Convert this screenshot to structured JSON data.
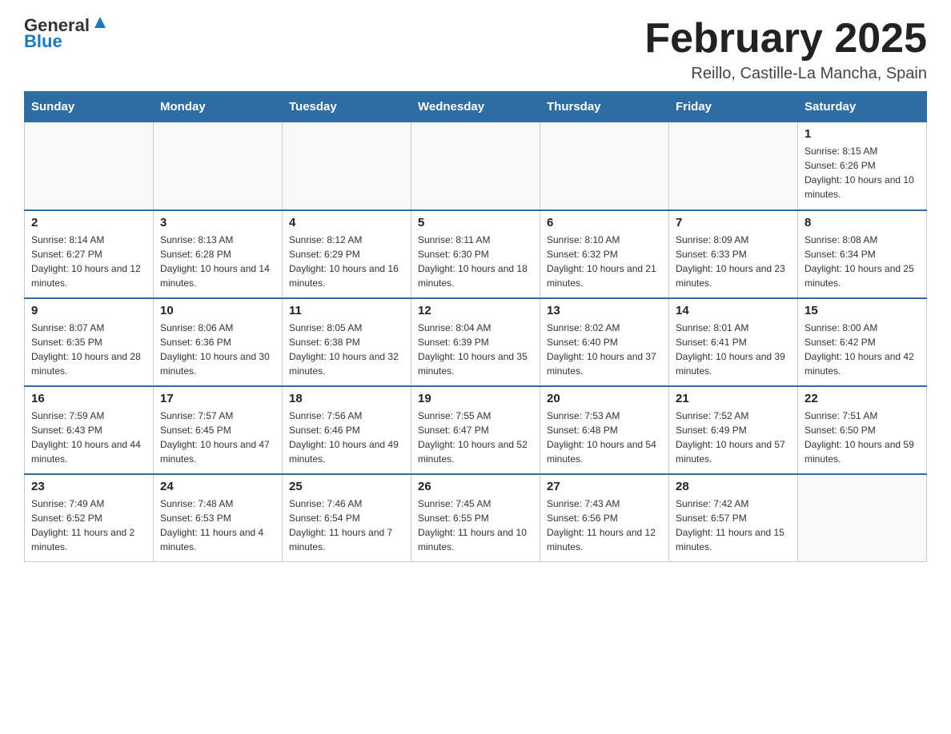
{
  "logo": {
    "general": "General",
    "blue": "Blue",
    "alt": "GeneralBlue logo"
  },
  "title": "February 2025",
  "location": "Reillo, Castille-La Mancha, Spain",
  "headers": [
    "Sunday",
    "Monday",
    "Tuesday",
    "Wednesday",
    "Thursday",
    "Friday",
    "Saturday"
  ],
  "weeks": [
    [
      {
        "day": "",
        "info": ""
      },
      {
        "day": "",
        "info": ""
      },
      {
        "day": "",
        "info": ""
      },
      {
        "day": "",
        "info": ""
      },
      {
        "day": "",
        "info": ""
      },
      {
        "day": "",
        "info": ""
      },
      {
        "day": "1",
        "info": "Sunrise: 8:15 AM\nSunset: 6:26 PM\nDaylight: 10 hours and 10 minutes."
      }
    ],
    [
      {
        "day": "2",
        "info": "Sunrise: 8:14 AM\nSunset: 6:27 PM\nDaylight: 10 hours and 12 minutes."
      },
      {
        "day": "3",
        "info": "Sunrise: 8:13 AM\nSunset: 6:28 PM\nDaylight: 10 hours and 14 minutes."
      },
      {
        "day": "4",
        "info": "Sunrise: 8:12 AM\nSunset: 6:29 PM\nDaylight: 10 hours and 16 minutes."
      },
      {
        "day": "5",
        "info": "Sunrise: 8:11 AM\nSunset: 6:30 PM\nDaylight: 10 hours and 18 minutes."
      },
      {
        "day": "6",
        "info": "Sunrise: 8:10 AM\nSunset: 6:32 PM\nDaylight: 10 hours and 21 minutes."
      },
      {
        "day": "7",
        "info": "Sunrise: 8:09 AM\nSunset: 6:33 PM\nDaylight: 10 hours and 23 minutes."
      },
      {
        "day": "8",
        "info": "Sunrise: 8:08 AM\nSunset: 6:34 PM\nDaylight: 10 hours and 25 minutes."
      }
    ],
    [
      {
        "day": "9",
        "info": "Sunrise: 8:07 AM\nSunset: 6:35 PM\nDaylight: 10 hours and 28 minutes."
      },
      {
        "day": "10",
        "info": "Sunrise: 8:06 AM\nSunset: 6:36 PM\nDaylight: 10 hours and 30 minutes."
      },
      {
        "day": "11",
        "info": "Sunrise: 8:05 AM\nSunset: 6:38 PM\nDaylight: 10 hours and 32 minutes."
      },
      {
        "day": "12",
        "info": "Sunrise: 8:04 AM\nSunset: 6:39 PM\nDaylight: 10 hours and 35 minutes."
      },
      {
        "day": "13",
        "info": "Sunrise: 8:02 AM\nSunset: 6:40 PM\nDaylight: 10 hours and 37 minutes."
      },
      {
        "day": "14",
        "info": "Sunrise: 8:01 AM\nSunset: 6:41 PM\nDaylight: 10 hours and 39 minutes."
      },
      {
        "day": "15",
        "info": "Sunrise: 8:00 AM\nSunset: 6:42 PM\nDaylight: 10 hours and 42 minutes."
      }
    ],
    [
      {
        "day": "16",
        "info": "Sunrise: 7:59 AM\nSunset: 6:43 PM\nDaylight: 10 hours and 44 minutes."
      },
      {
        "day": "17",
        "info": "Sunrise: 7:57 AM\nSunset: 6:45 PM\nDaylight: 10 hours and 47 minutes."
      },
      {
        "day": "18",
        "info": "Sunrise: 7:56 AM\nSunset: 6:46 PM\nDaylight: 10 hours and 49 minutes."
      },
      {
        "day": "19",
        "info": "Sunrise: 7:55 AM\nSunset: 6:47 PM\nDaylight: 10 hours and 52 minutes."
      },
      {
        "day": "20",
        "info": "Sunrise: 7:53 AM\nSunset: 6:48 PM\nDaylight: 10 hours and 54 minutes."
      },
      {
        "day": "21",
        "info": "Sunrise: 7:52 AM\nSunset: 6:49 PM\nDaylight: 10 hours and 57 minutes."
      },
      {
        "day": "22",
        "info": "Sunrise: 7:51 AM\nSunset: 6:50 PM\nDaylight: 10 hours and 59 minutes."
      }
    ],
    [
      {
        "day": "23",
        "info": "Sunrise: 7:49 AM\nSunset: 6:52 PM\nDaylight: 11 hours and 2 minutes."
      },
      {
        "day": "24",
        "info": "Sunrise: 7:48 AM\nSunset: 6:53 PM\nDaylight: 11 hours and 4 minutes."
      },
      {
        "day": "25",
        "info": "Sunrise: 7:46 AM\nSunset: 6:54 PM\nDaylight: 11 hours and 7 minutes."
      },
      {
        "day": "26",
        "info": "Sunrise: 7:45 AM\nSunset: 6:55 PM\nDaylight: 11 hours and 10 minutes."
      },
      {
        "day": "27",
        "info": "Sunrise: 7:43 AM\nSunset: 6:56 PM\nDaylight: 11 hours and 12 minutes."
      },
      {
        "day": "28",
        "info": "Sunrise: 7:42 AM\nSunset: 6:57 PM\nDaylight: 11 hours and 15 minutes."
      },
      {
        "day": "",
        "info": ""
      }
    ]
  ]
}
